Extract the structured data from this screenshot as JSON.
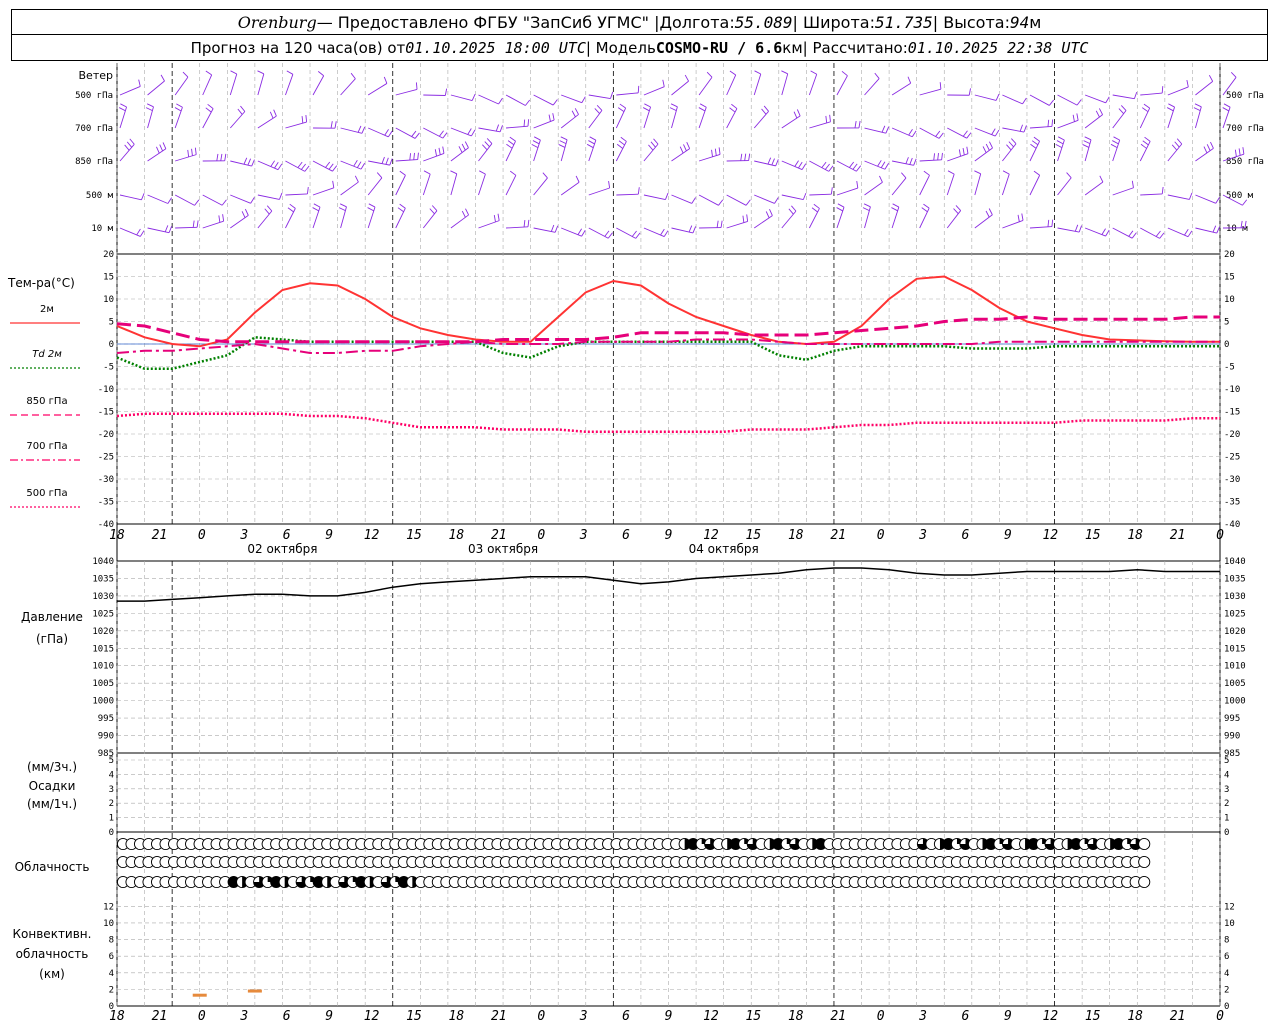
{
  "header": {
    "city": "Orenburg",
    "provided_by": "— Предоставлено ФГБУ \"ЗапСиб УГМС\" |",
    "lon_label": "Долгота:",
    "lon_value": "55.089",
    "lat_label": "| Широта:",
    "lat_value": "51.735",
    "alt_label": "| Высота:",
    "alt_value": "94",
    "alt_unit": "м",
    "forecast_label": "Прогноз на 120 часа(ов) от",
    "forecast_time": "01.10.2025 18:00 UTC",
    "model_label": "| Модель",
    "model_name": "COSMO-RU / 6.6",
    "model_unit": "км",
    "calc_label": "| Рассчитано:",
    "calc_time": "01.10.2025 22:38 UTC"
  },
  "wind_panel": {
    "title": "Ветер",
    "levels": [
      "500 гПа",
      "700 гПа",
      "850 гПа",
      "500 м",
      "10 м"
    ],
    "color": "#8a2be2"
  },
  "temp_panel": {
    "title": "Тем-ра(°C)",
    "legend": [
      {
        "label": "2м",
        "color": "#ff3333",
        "style": "solid"
      },
      {
        "label": "Td 2м",
        "color": "#008000",
        "style": "dotted"
      },
      {
        "label": "850 гПа",
        "color": "#ff0066",
        "style": "dashed"
      },
      {
        "label": "700 гПа",
        "color": "#ff0066",
        "style": "dashdot"
      },
      {
        "label": "500 гПа",
        "color": "#ff0066",
        "style": "dotted"
      }
    ],
    "ticks": [
      "20",
      "15",
      "10",
      "5",
      "0",
      "-5",
      "-10",
      "-15",
      "-20",
      "-25",
      "-30",
      "-35",
      "-40"
    ]
  },
  "time_axis": {
    "hour_labels": [
      "18",
      "21",
      "0",
      "3",
      "6",
      "9",
      "12",
      "15",
      "18",
      "21",
      "0",
      "3",
      "6",
      "9",
      "12",
      "15",
      "18",
      "21",
      "0",
      "3",
      "6",
      "9",
      "12",
      "15",
      "18",
      "21",
      "0"
    ],
    "dates": [
      "02 октября",
      "03 октября",
      "04 октября"
    ]
  },
  "pressure_panel": {
    "title": "Давление",
    "unit": "(гПа)",
    "ticks": [
      "1040",
      "1035",
      "1030",
      "1025",
      "1020",
      "1015",
      "1010",
      "1005",
      "1000",
      "995",
      "990",
      "985"
    ]
  },
  "precip_panel": {
    "unit1": "(мм/3ч.)",
    "title": "Осадки",
    "unit2": "(мм/1ч.)",
    "ticks": [
      "5",
      "4",
      "3",
      "2",
      "1",
      "0"
    ]
  },
  "cloud_panel": {
    "title": "Облачность"
  },
  "conv_panel": {
    "title1": "Конвективн.",
    "title2": "облачность",
    "unit": "(км)",
    "ticks": [
      "12",
      "10",
      "8",
      "6",
      "4",
      "2",
      "0"
    ]
  },
  "chart_data": {
    "type": "line",
    "x_hours": [
      0,
      3,
      6,
      9,
      12,
      15,
      18,
      21,
      24,
      27,
      30,
      33,
      36,
      39,
      42,
      45,
      48,
      51,
      54,
      57,
      60,
      63,
      66,
      69,
      72,
      75,
      78,
      81,
      84,
      87,
      90,
      93,
      96,
      99,
      102,
      105,
      108,
      111,
      114,
      117,
      120
    ],
    "series": [
      {
        "name": "2м",
        "values": [
          4,
          1.5,
          0,
          -0.5,
          1,
          7,
          12,
          13.5,
          13,
          10,
          6,
          3.5,
          2,
          1,
          0.5,
          0.5,
          6,
          11.5,
          14,
          13,
          9,
          6,
          4,
          2,
          0.5,
          0,
          0.5,
          4,
          10,
          14.5,
          15,
          12,
          8,
          5,
          3.5,
          2,
          1,
          0.8,
          0.6,
          0.5,
          0.5
        ]
      },
      {
        "name": "Td 2м",
        "values": [
          -3,
          -5.5,
          -5.5,
          -4,
          -2.5,
          1.5,
          1,
          0.5,
          0.5,
          0.5,
          0.5,
          0.5,
          0.5,
          0.5,
          -2,
          -3,
          -0.5,
          0.5,
          0.5,
          0.5,
          0.5,
          0.5,
          0.5,
          0.5,
          -2.5,
          -3.5,
          -1.5,
          -0.5,
          -0.5,
          -0.5,
          -0.5,
          -1,
          -1,
          -1,
          -0.5,
          -0.5,
          -0.5,
          -0.5,
          -0.5,
          -0.5,
          -0.5
        ]
      },
      {
        "name": "850 гПа",
        "values": [
          4.5,
          4,
          2.5,
          1,
          0.5,
          0.5,
          0.5,
          0.5,
          0.5,
          0.5,
          0.5,
          0.5,
          0.5,
          0.5,
          1,
          1,
          1,
          1,
          1.5,
          2.5,
          2.5,
          2.5,
          2.5,
          2,
          2,
          2,
          2.5,
          3,
          3.5,
          4,
          5,
          5.5,
          5.5,
          6,
          5.5,
          5.5,
          5.5,
          5.5,
          5.5,
          6,
          6
        ]
      },
      {
        "name": "700 гПа",
        "values": [
          -2,
          -1.5,
          -1.5,
          -1,
          -0.5,
          0,
          -1,
          -2,
          -2,
          -1.5,
          -1.5,
          -0.5,
          0,
          0.5,
          0,
          0,
          0,
          0.5,
          0.5,
          0.5,
          0.5,
          1,
          1,
          1,
          0.5,
          0,
          0,
          0,
          0,
          0,
          0,
          0,
          0.5,
          0.5,
          0.5,
          0.5,
          0.5,
          0.5,
          0.5,
          0.5,
          0.5
        ]
      },
      {
        "name": "500 гПа",
        "values": [
          -16,
          -15.5,
          -15.5,
          -15.5,
          -15.5,
          -15.5,
          -15.5,
          -16,
          -16,
          -16.5,
          -17.5,
          -18.5,
          -18.5,
          -18.5,
          -19,
          -19,
          -19,
          -19.5,
          -19.5,
          -19.5,
          -19.5,
          -19.5,
          -19.5,
          -19,
          -19,
          -19,
          -18.5,
          -18,
          -18,
          -17.5,
          -17.5,
          -17.5,
          -17.5,
          -17.5,
          -17.5,
          -17,
          -17,
          -17,
          -17,
          -16.5,
          -16.5
        ]
      },
      {
        "name": "Давление",
        "values": [
          1028.5,
          1028.5,
          1029,
          1029.5,
          1030,
          1030.5,
          1030.5,
          1030,
          1030,
          1031,
          1032.5,
          1033.5,
          1034,
          1034.5,
          1035,
          1035.5,
          1035.5,
          1035.5,
          1034.5,
          1033.5,
          1034,
          1035,
          1035.5,
          1036,
          1036.5,
          1037.5,
          1038,
          1038,
          1037.5,
          1036.5,
          1036,
          1036,
          1036.5,
          1037,
          1037,
          1037,
          1037,
          1037.5,
          1037,
          1037,
          1037
        ]
      }
    ],
    "temp_ylim": [
      -40,
      20
    ],
    "pressure_ylim": [
      985,
      1040
    ],
    "precip_ylim": [
      0,
      5
    ],
    "conv_ylim": [
      0,
      13
    ],
    "conv_cloud": [
      {
        "hour": 9,
        "value": 1.3
      },
      {
        "hour": 15,
        "value": 1.8
      }
    ],
    "grid": true,
    "wind_barbs": true
  }
}
